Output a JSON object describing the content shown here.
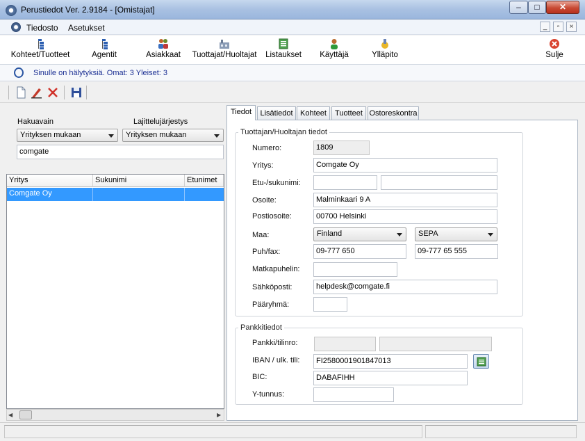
{
  "window": {
    "title": "Perustiedot Ver. 2.9184 - [Omistajat]",
    "minimize": "‒",
    "maximize": "□",
    "close": "✕"
  },
  "menubar": {
    "items": [
      "Tiedosto",
      "Asetukset"
    ],
    "mdi_min": "_",
    "mdi_restore": "▫",
    "mdi_close": "×"
  },
  "toolbar": {
    "items": [
      {
        "label": "Kohteet/Tuotteet",
        "icon": "tree-icon"
      },
      {
        "label": "Agentit",
        "icon": "tree-icon"
      },
      {
        "label": "Asiakkaat",
        "icon": "people-icon"
      },
      {
        "label": "Tuottajat/Huoltajat",
        "icon": "factory-icon"
      },
      {
        "label": "Listaukset",
        "icon": "list-icon"
      },
      {
        "label": "Käyttäjä",
        "icon": "user-icon"
      },
      {
        "label": "Ylläpito",
        "icon": "maintenance-icon"
      },
      {
        "label": "Sulje",
        "icon": "close-icon"
      }
    ]
  },
  "status": {
    "text": "Sinulle on hälytyksiä.  Omat: 3   Yleiset: 3"
  },
  "left": {
    "search_key_label": "Hakuavain",
    "sort_label": "Lajittelujärjestys",
    "search_key_value": "Yrityksen mukaan",
    "sort_value": "Yrityksen mukaan",
    "search_input": "comgate",
    "columns": [
      "Yritys",
      "Sukunimi",
      "Etunimet"
    ],
    "rows": [
      {
        "yritys": "Comgate Oy",
        "sukunimi": "",
        "etunimet": ""
      }
    ]
  },
  "tabs": [
    "Tiedot",
    "Lisätiedot",
    "Kohteet",
    "Tuotteet",
    "Ostoreskontra"
  ],
  "producer": {
    "group_title": "Tuottajan/Huoltajan tiedot",
    "labels": {
      "numero": "Numero:",
      "yritys": "Yritys:",
      "nimi": "Etu-/sukunimi:",
      "osoite": "Osoite:",
      "postiosoite": "Postiosoite:",
      "maa": "Maa:",
      "puhfax": "Puh/fax:",
      "matkapuhelin": "Matkapuhelin:",
      "sahkoposti": "Sähköposti:",
      "paaryhma": "Pääryhmä:"
    },
    "values": {
      "numero": "1809",
      "yritys": "Comgate Oy",
      "etunimi": "",
      "sukunimi": "",
      "osoite": "Malminkaari 9 A",
      "postiosoite": "00700 Helsinki",
      "maa": "Finland",
      "maksu": "SEPA",
      "puh": "09-777 650",
      "fax": "09-777 65 555",
      "matkapuhelin": "",
      "sahkoposti": "helpdesk@comgate.fi",
      "paaryhma": ""
    }
  },
  "bank": {
    "group_title": "Pankkitiedot",
    "labels": {
      "pankki": "Pankki/tilinro:",
      "iban": "IBAN / ulk. tili:",
      "bic": "BIC:",
      "ytunnus": "Y-tunnus:"
    },
    "values": {
      "pankki": "",
      "tilinro": "",
      "iban": "FI2580001901847013",
      "bic": "DABAFIHH",
      "ytunnus": ""
    }
  },
  "colors": {
    "selection": "#3399ff",
    "status_text": "#1b2f93",
    "close_red": "#c84a34"
  }
}
